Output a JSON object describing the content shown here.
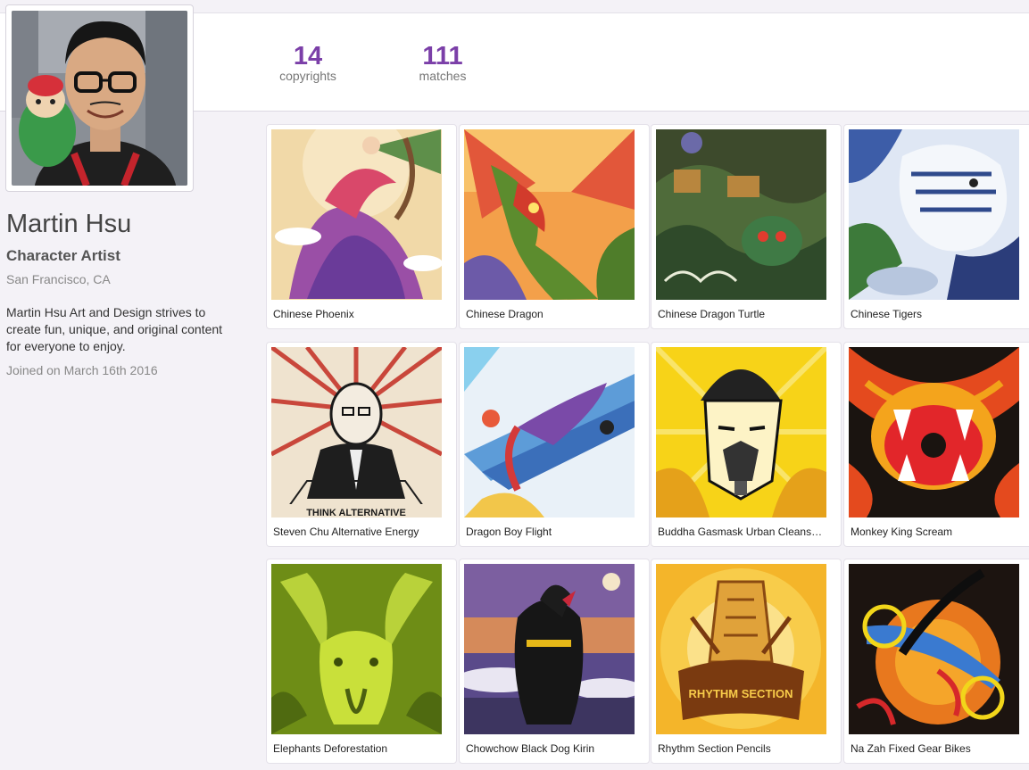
{
  "stats": {
    "copyrights": {
      "value": "14",
      "label": "copyrights"
    },
    "matches": {
      "value": "111",
      "label": "matches"
    }
  },
  "profile": {
    "name": "Martin Hsu",
    "title": "Character Artist",
    "location": "San Francisco, CA",
    "bio": "Martin Hsu Art and Design strives to create fun, unique, and original content for everyone to enjoy.",
    "joined": "Joined on March 16th 2016"
  },
  "artworks": [
    {
      "title": "Chinese Phoenix"
    },
    {
      "title": "Chinese Dragon"
    },
    {
      "title": "Chinese Dragon Turtle"
    },
    {
      "title": "Chinese Tigers"
    },
    {
      "title": "Steven Chu Alternative Energy",
      "poster_text": "THINK ALTERNATIVE"
    },
    {
      "title": "Dragon Boy Flight"
    },
    {
      "title": "Buddha Gasmask Urban Cleans…"
    },
    {
      "title": "Monkey King Scream"
    },
    {
      "title": "Elephants Deforestation"
    },
    {
      "title": "Chowchow Black Dog Kirin"
    },
    {
      "title": "Rhythm Section Pencils",
      "poster_text": "RHYTHM SECTION"
    },
    {
      "title": "Na Zah Fixed Gear Bikes"
    }
  ],
  "colors": {
    "accent": "#7b3fa8",
    "background": "#f4f2f7"
  }
}
